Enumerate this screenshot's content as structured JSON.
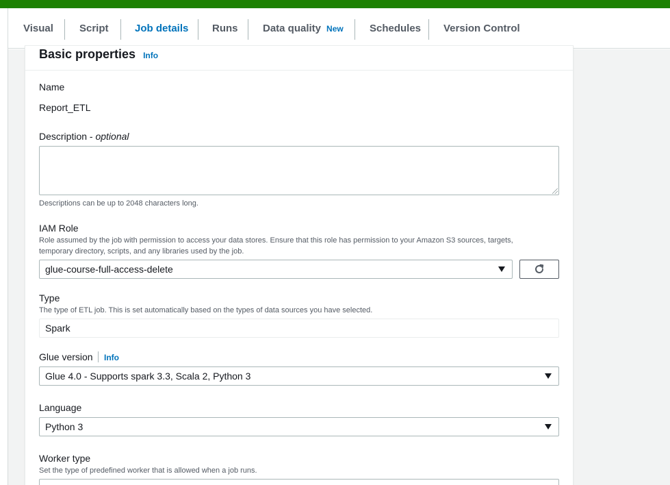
{
  "tabs": [
    {
      "label": "Visual"
    },
    {
      "label": "Script"
    },
    {
      "label": "Job details"
    },
    {
      "label": "Runs"
    },
    {
      "label": "Data quality",
      "badge": "New"
    },
    {
      "label": "Schedules"
    },
    {
      "label": "Version Control"
    }
  ],
  "active_tab": "Job details",
  "panel": {
    "title": "Basic properties",
    "info": "Info"
  },
  "name": {
    "label": "Name",
    "value": "Report_ETL"
  },
  "description": {
    "label": "Description - ",
    "optional": "optional",
    "value": "",
    "hint": "Descriptions can be up to 2048 characters long."
  },
  "iam_role": {
    "label": "IAM Role",
    "hint": "Role assumed by the job with permission to access your data stores. Ensure that this role has permission to your Amazon S3 sources, targets, temporary directory, scripts, and any libraries used by the job.",
    "value": "glue-course-full-access-delete"
  },
  "type": {
    "label": "Type",
    "hint": "The type of ETL job. This is set automatically based on the types of data sources you have selected.",
    "value": "Spark"
  },
  "glue_version": {
    "label": "Glue version",
    "info": "Info",
    "value": "Glue 4.0 - Supports spark 3.3, Scala 2, Python 3"
  },
  "language": {
    "label": "Language",
    "value": "Python 3"
  },
  "worker_type": {
    "label": "Worker type",
    "hint": "Set the type of predefined worker that is allowed when a job runs."
  },
  "colors": {
    "accent": "#0073bb",
    "top_bar": "#1d8102"
  },
  "icons": {
    "refresh": "refresh-icon",
    "dropdown": "caret-down-icon"
  }
}
